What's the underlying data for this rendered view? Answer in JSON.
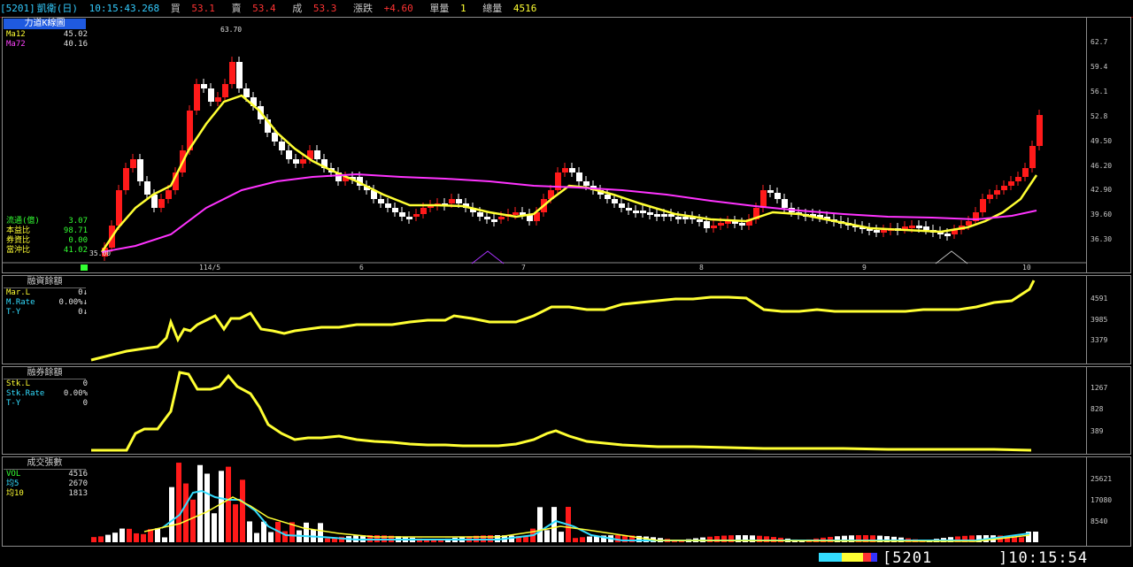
{
  "header": {
    "code": "[5201]",
    "name": "凱衛(日)",
    "time": "10:15:43.268",
    "buy_label": "買",
    "buy": "53.1",
    "sell_label": "賣",
    "sell": "53.4",
    "deal_label": "成",
    "deal": "53.3",
    "change_label": "漲跌",
    "change": "+4.60",
    "single_label": "單量",
    "single": "1",
    "total_label": "總量",
    "total": "4516"
  },
  "colors": {
    "up": "#ff1a1a",
    "down": "#ffffff",
    "ma12": "#ffff33",
    "ma72": "#ff33ff",
    "cyan": "#33ddff",
    "green": "#33ff33"
  },
  "price_panel": {
    "title": "力道K線圖",
    "legend": [
      {
        "name": "Ma12",
        "value": "45.02",
        "color": "#ffff33"
      },
      {
        "name": "Ma72",
        "value": "40.16",
        "color": "#ff33ff"
      }
    ],
    "stats": [
      {
        "name": "流通(億)",
        "value": "3.07"
      },
      {
        "name": "本益比",
        "value": "98.71"
      },
      {
        "name": "券資比",
        "value": "0.00"
      },
      {
        "name": "當沖比",
        "value": "41.02"
      }
    ],
    "y_ticks": [
      "62.7",
      "59.4",
      "56.1",
      "52.8",
      "49.50",
      "46.20",
      "42.90",
      "39.60",
      "36.30"
    ],
    "x_ticks": [
      "114/5",
      "6",
      "7",
      "8",
      "9",
      "10"
    ],
    "high_label": "63.70",
    "low_label": "35.00"
  },
  "margin_panel": {
    "title": "融資餘額",
    "legend": [
      {
        "name": "Mar.L",
        "value": "0↓"
      },
      {
        "name": "M.Rate",
        "value": "0.00%↓"
      },
      {
        "name": "T-Y",
        "value": "0↓"
      }
    ],
    "y_ticks": [
      "4591",
      "3985",
      "3379"
    ]
  },
  "short_panel": {
    "title": "融券餘額",
    "legend": [
      {
        "name": "Stk.L",
        "value": "0"
      },
      {
        "name": "Stk.Rate",
        "value": "0.00%"
      },
      {
        "name": "T-Y",
        "value": "0"
      }
    ],
    "y_ticks": [
      "1267",
      "828",
      "389"
    ]
  },
  "volume_panel": {
    "title": "成交張數",
    "legend": [
      {
        "name": "VOL",
        "value": "4516"
      },
      {
        "name": "均5",
        "value": "2670"
      },
      {
        "name": "均10",
        "value": "1813"
      }
    ],
    "y_ticks": [
      "25621",
      "17080",
      "8540"
    ]
  },
  "status": {
    "code": "5201",
    "time": "10:15:54"
  }
}
